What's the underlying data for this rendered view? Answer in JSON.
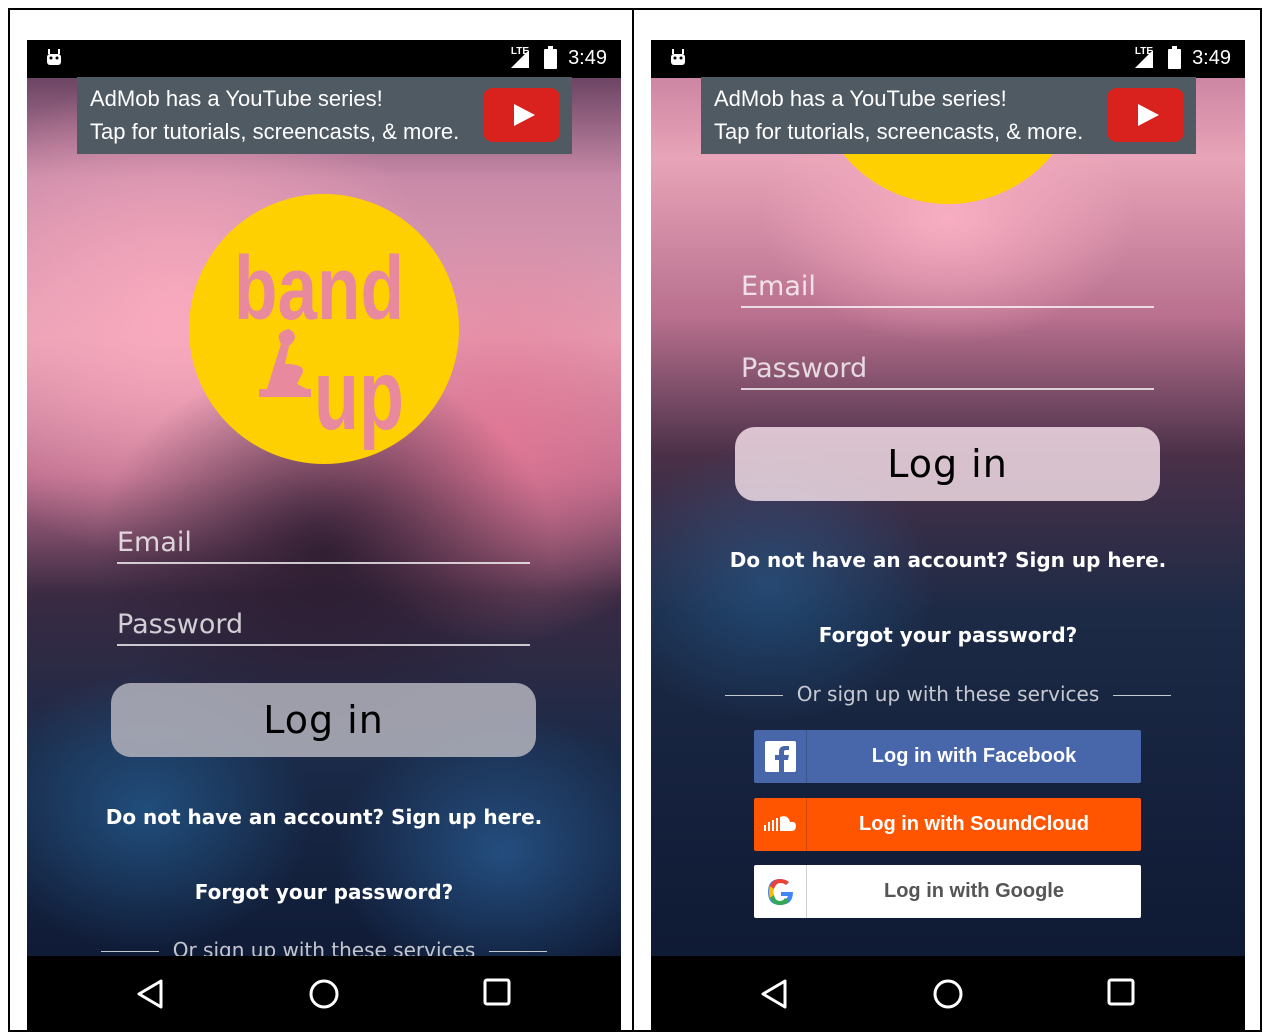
{
  "status": {
    "network": "LTE",
    "time": "3:49"
  },
  "ad": {
    "line1": "AdMob has a YouTube series!",
    "line2": "Tap for tutorials, screencasts, & more."
  },
  "logo": {
    "word1": "band",
    "word2": "up"
  },
  "form": {
    "email_placeholder": "Email",
    "password_placeholder": "Password",
    "login_label": "Log in",
    "signup_link": "Do not have an account? Sign up here.",
    "forgot_link": "Forgot your password?",
    "divider_text": "Or sign up with these services"
  },
  "social": {
    "facebook_label": "Log in with Facebook",
    "soundcloud_label": "Log in with SoundCloud",
    "google_label": "Log in with Google"
  },
  "colors": {
    "logo_yellow": "#fed002",
    "logo_text_pink": "#e8899e",
    "facebook": "#4867aa",
    "soundcloud": "#ff5500",
    "google_text": "#555555",
    "ad_bg": "#505a63",
    "youtube_red": "#d9221e"
  },
  "icons": [
    "android-icon",
    "signal-icon",
    "battery-charging-icon",
    "youtube-play-icon",
    "facebook-icon",
    "soundcloud-icon",
    "google-icon",
    "back-icon",
    "home-icon",
    "recents-icon"
  ]
}
